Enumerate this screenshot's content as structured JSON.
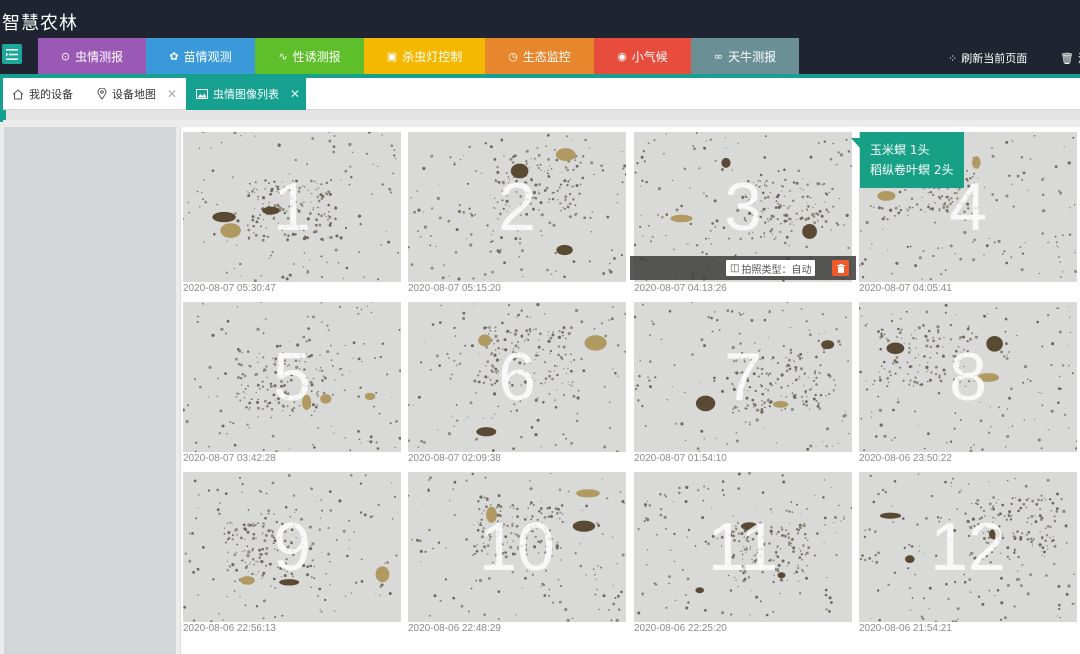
{
  "app": {
    "title": "智慧农林"
  },
  "nav": [
    {
      "label": "虫情测报",
      "icon": "crosshair-icon",
      "glyph": "⊙",
      "color": "#9b59b6",
      "width": 108
    },
    {
      "label": "苗情观测",
      "icon": "sprout-icon",
      "glyph": "✿",
      "color": "#3a9ad9",
      "width": 109
    },
    {
      "label": "性诱测报",
      "icon": "pulse-icon",
      "glyph": "∿",
      "color": "#5fbf2a",
      "width": 109
    },
    {
      "label": "杀虫灯控制",
      "icon": "lamp-icon",
      "glyph": "▣",
      "color": "#f5b800",
      "width": 121
    },
    {
      "label": "生态监控",
      "icon": "clock-icon",
      "glyph": "◷",
      "color": "#e8862d",
      "width": 109
    },
    {
      "label": "小气候",
      "icon": "compass-icon",
      "glyph": "◉",
      "color": "#e74c3c",
      "width": 97
    },
    {
      "label": "天牛测报",
      "icon": "link-icon",
      "glyph": "∞",
      "color": "#6a8f95",
      "width": 108
    }
  ],
  "header_actions": {
    "refresh": "刷新当前页面",
    "clear": "清"
  },
  "tabs": [
    {
      "label": "我的设备",
      "icon": "home-icon",
      "closable": false
    },
    {
      "label": "设备地图",
      "icon": "map-pin-icon",
      "closable": true
    },
    {
      "label": "虫情图像列表",
      "icon": "image-icon",
      "closable": true
    }
  ],
  "images": [
    {
      "number": "1",
      "timestamp": "2020-08-07 05:30:47"
    },
    {
      "number": "2",
      "timestamp": "2020-08-07 05:15:20"
    },
    {
      "number": "3",
      "timestamp": "2020-08-07 04:13:26"
    },
    {
      "number": "4",
      "timestamp": "2020-08-07 04:05:41"
    },
    {
      "number": "5",
      "timestamp": "2020-08-07 03:42:28"
    },
    {
      "number": "6",
      "timestamp": "2020-08-07 02:09:38"
    },
    {
      "number": "7",
      "timestamp": "2020-08-07 01:54:10"
    },
    {
      "number": "8",
      "timestamp": "2020-08-06 23:50:22"
    },
    {
      "number": "9",
      "timestamp": "2020-08-06 22:56:13"
    },
    {
      "number": "10",
      "timestamp": "2020-08-06 22:48:29"
    },
    {
      "number": "11",
      "timestamp": "2020-08-06 22:25:20"
    },
    {
      "number": "12",
      "timestamp": "2020-08-06 21:54:21"
    }
  ],
  "overlay": {
    "photo_type": "拍照类型：自动",
    "delete_icon": "trash-icon"
  },
  "tooltip": {
    "line1": "玉米螟 1头",
    "line2": "稻纵卷叶螟 2头"
  },
  "colors": {
    "header": "#1f2430",
    "accent": "#16a08f",
    "delete": "#f05a2a"
  }
}
